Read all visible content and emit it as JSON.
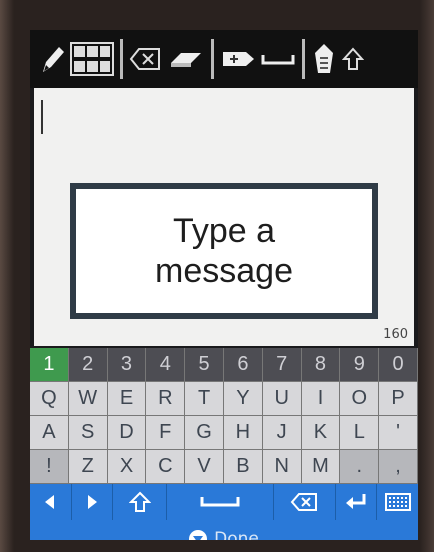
{
  "overlay": {
    "line1": "Type a",
    "line2": "message"
  },
  "textarea": {
    "char_counter": "160"
  },
  "keyboard": {
    "number_row": [
      "1",
      "2",
      "3",
      "4",
      "5",
      "6",
      "7",
      "8",
      "9",
      "0"
    ],
    "row1": [
      "Q",
      "W",
      "E",
      "R",
      "T",
      "Y",
      "U",
      "I",
      "O",
      "P"
    ],
    "row2": [
      "A",
      "S",
      "D",
      "F",
      "G",
      "H",
      "J",
      "K",
      "L",
      "'"
    ],
    "row3": [
      "!",
      "Z",
      "X",
      "C",
      "V",
      "B",
      "N",
      "M",
      ".",
      ","
    ],
    "selected_number": "1",
    "nav_icons": [
      "arrow-left-icon",
      "arrow-right-icon",
      "shift-icon",
      "space-icon",
      "backspace-icon",
      "enter-icon",
      "keyboard-icon"
    ]
  },
  "footer": {
    "done_label": "Done"
  },
  "toolbar": {
    "icons": [
      "pencil-icon",
      "templates-icon",
      "backspace-icon",
      "eraser-icon",
      "insert-icon",
      "space-icon",
      "shift-case-icon",
      "arrow-up-icon"
    ]
  },
  "colors": {
    "selected": "#3f9a4e",
    "nav_bar": "#2a79d8",
    "frame": "#2f3b46"
  }
}
